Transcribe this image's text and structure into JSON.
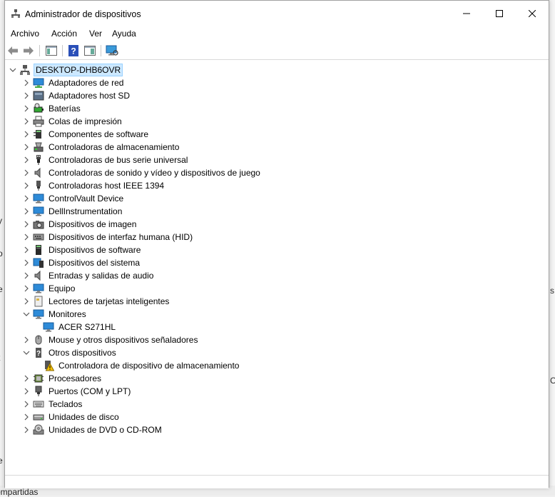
{
  "window": {
    "title": "Administrador de dispositivos"
  },
  "menu": [
    "Archivo",
    "Acción",
    "Ver",
    "Ayuda"
  ],
  "toolbar": [
    "back-arrow-icon",
    "forward-arrow-icon",
    "properties-panel-icon",
    "help-icon",
    "view-panel-icon",
    "monitor-scan-icon"
  ],
  "tree": [
    {
      "label": "DESKTOP-DHB6OVR",
      "icon": "computer-icon",
      "level": 0,
      "state": "expanded",
      "name": "tree-root-desktop"
    },
    {
      "label": "Adaptadores de red",
      "icon": "network-adapter-icon",
      "level": 1,
      "state": "collapsed",
      "name": "tree-item-adaptadores-red"
    },
    {
      "label": "Adaptadores host SD",
      "icon": "sd-host-icon",
      "level": 1,
      "state": "collapsed",
      "name": "tree-item-adaptadores-sd"
    },
    {
      "label": "Baterías",
      "icon": "battery-icon",
      "level": 1,
      "state": "collapsed",
      "name": "tree-item-baterias"
    },
    {
      "label": "Colas de impresión",
      "icon": "printer-icon",
      "level": 1,
      "state": "collapsed",
      "name": "tree-item-colas-impresion"
    },
    {
      "label": "Componentes de software",
      "icon": "software-component-icon",
      "level": 1,
      "state": "collapsed",
      "name": "tree-item-componentes-software"
    },
    {
      "label": "Controladoras de almacenamiento",
      "icon": "storage-controller-icon",
      "level": 1,
      "state": "collapsed",
      "name": "tree-item-controladoras-almacenamiento"
    },
    {
      "label": "Controladoras de bus serie universal",
      "icon": "usb-icon",
      "level": 1,
      "state": "collapsed",
      "name": "tree-item-controladoras-usb"
    },
    {
      "label": "Controladoras de sonido y vídeo y dispositivos de juego",
      "icon": "speaker-icon",
      "level": 1,
      "state": "collapsed",
      "name": "tree-item-sonido-video"
    },
    {
      "label": "Controladoras host IEEE 1394",
      "icon": "ieee1394-icon",
      "level": 1,
      "state": "collapsed",
      "name": "tree-item-ieee1394"
    },
    {
      "label": "ControlVault Device",
      "icon": "monitor-icon",
      "level": 1,
      "state": "collapsed",
      "name": "tree-item-controlvault"
    },
    {
      "label": "DellInstrumentation",
      "icon": "monitor-icon",
      "level": 1,
      "state": "collapsed",
      "name": "tree-item-dellinstrumentation"
    },
    {
      "label": "Dispositivos de imagen",
      "icon": "camera-icon",
      "level": 1,
      "state": "collapsed",
      "name": "tree-item-dispositivos-imagen"
    },
    {
      "label": "Dispositivos de interfaz humana (HID)",
      "icon": "hid-icon",
      "level": 1,
      "state": "collapsed",
      "name": "tree-item-hid"
    },
    {
      "label": "Dispositivos de software",
      "icon": "software-device-icon",
      "level": 1,
      "state": "collapsed",
      "name": "tree-item-dispositivos-software"
    },
    {
      "label": "Dispositivos del sistema",
      "icon": "system-device-icon",
      "level": 1,
      "state": "collapsed",
      "name": "tree-item-dispositivos-sistema"
    },
    {
      "label": "Entradas y salidas de audio",
      "icon": "speaker-icon",
      "level": 1,
      "state": "collapsed",
      "name": "tree-item-audio"
    },
    {
      "label": "Equipo",
      "icon": "monitor-icon",
      "level": 1,
      "state": "collapsed",
      "name": "tree-item-equipo"
    },
    {
      "label": "Lectores de tarjetas inteligentes",
      "icon": "smart-card-icon",
      "level": 1,
      "state": "collapsed",
      "name": "tree-item-lectores-tarjetas"
    },
    {
      "label": "Monitores",
      "icon": "monitor-icon",
      "level": 1,
      "state": "expanded",
      "name": "tree-item-monitores"
    },
    {
      "label": "ACER S271HL",
      "icon": "monitor-icon",
      "level": 2,
      "state": "leaf",
      "name": "tree-item-acer-s271hl"
    },
    {
      "label": "Mouse y otros dispositivos señaladores",
      "icon": "mouse-icon",
      "level": 1,
      "state": "collapsed",
      "name": "tree-item-mouse"
    },
    {
      "label": "Otros dispositivos",
      "icon": "other-devices-icon",
      "level": 1,
      "state": "expanded",
      "name": "tree-item-otros-dispositivos"
    },
    {
      "label": "Controladora de dispositivo de almacenamiento",
      "icon": "warning-device-icon",
      "level": 2,
      "state": "leaf",
      "name": "tree-item-controladora-almacenamiento-warning"
    },
    {
      "label": "Procesadores",
      "icon": "processor-icon",
      "level": 1,
      "state": "collapsed",
      "name": "tree-item-procesadores"
    },
    {
      "label": "Puertos (COM y LPT)",
      "icon": "port-icon",
      "level": 1,
      "state": "collapsed",
      "name": "tree-item-puertos"
    },
    {
      "label": "Teclados",
      "icon": "keyboard-icon",
      "level": 1,
      "state": "collapsed",
      "name": "tree-item-teclados"
    },
    {
      "label": "Unidades de disco",
      "icon": "disk-drive-icon",
      "level": 1,
      "state": "collapsed",
      "name": "tree-item-unidades-disco"
    },
    {
      "label": "Unidades de DVD o CD-ROM",
      "icon": "dvd-icon",
      "level": 1,
      "state": "collapsed",
      "name": "tree-item-unidades-dvd"
    }
  ],
  "background": {
    "bottom_text": "ompartidas",
    "left_chars": [
      "y",
      "o",
      "e",
      "t",
      "e"
    ],
    "right_chars": [
      "s",
      "C"
    ]
  },
  "colors": {
    "selection": "#cce8ff",
    "monitor": "#2e8bd8",
    "warning": "#f5c000"
  }
}
